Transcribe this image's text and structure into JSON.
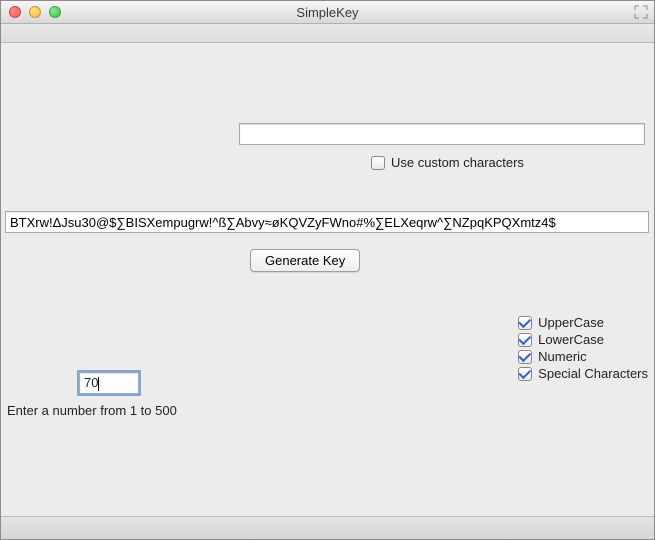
{
  "window": {
    "title": "SimpleKey"
  },
  "custom": {
    "input_value": "",
    "checkbox_label": "Use custom characters",
    "checkbox_checked": false
  },
  "output": {
    "generated_key": "BTXrw!ΔJsu30@$∑BISXempugrw!^ß∑Abvy≈øKQVZyFWno#%∑ELXeqrw^∑NZpqKPQXmtz4$"
  },
  "actions": {
    "generate_label": "Generate Key"
  },
  "options": {
    "uppercase": {
      "label": "UpperCase",
      "checked": true
    },
    "lowercase": {
      "label": "LowerCase",
      "checked": true
    },
    "numeric": {
      "label": "Numeric",
      "checked": true
    },
    "special": {
      "label": "Special Characters",
      "checked": true
    }
  },
  "length": {
    "value": "70",
    "hint": "Enter a number from 1 to 500"
  }
}
